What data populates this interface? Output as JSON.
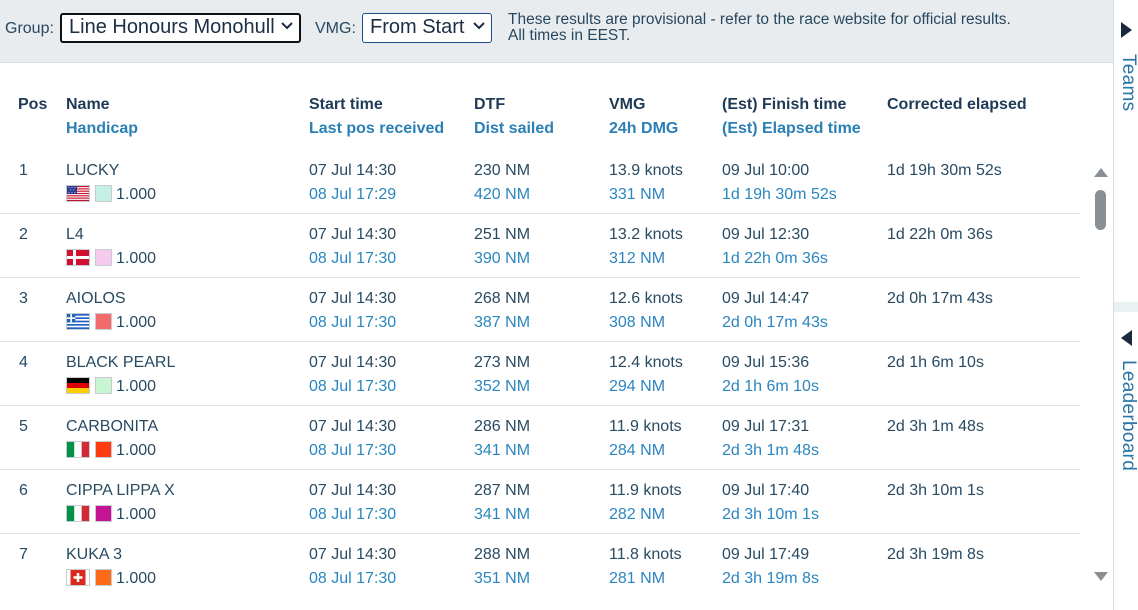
{
  "toolbar": {
    "group_label": "Group:",
    "group_value": "Line Honours Monohull",
    "vmg_label": "VMG:",
    "vmg_value": "From Start",
    "notice_line1": "These results are provisional - refer to the race website for official results.",
    "notice_line2": "All times in EEST."
  },
  "side_tabs": {
    "teams": "Teams",
    "leaderboard": "Leaderboard"
  },
  "columns": [
    {
      "main": "Pos",
      "sub": ""
    },
    {
      "main": "Name",
      "sub": "Handicap"
    },
    {
      "main": "Start time",
      "sub": "Last pos received"
    },
    {
      "main": "DTF",
      "sub": "Dist sailed"
    },
    {
      "main": "VMG",
      "sub": "24h DMG"
    },
    {
      "main": "(Est) Finish time",
      "sub": "(Est) Elapsed time"
    },
    {
      "main": "Corrected elapsed",
      "sub": ""
    }
  ],
  "rows": [
    {
      "pos": "1",
      "name": "LUCKY",
      "flag": "us-flag",
      "color": "#c7f0e4",
      "handicap": "1.000",
      "start": "07 Jul 14:30",
      "last": "08 Jul 17:29",
      "dtf": "230 NM",
      "sailed": "420 NM",
      "vmg": "13.9 knots",
      "dmg": "331 NM",
      "finish": "09 Jul 10:00",
      "elapsed": "1d 19h 30m 52s",
      "corrected": "1d 19h 30m 52s"
    },
    {
      "pos": "2",
      "name": "L4",
      "flag": "dk-flag",
      "color": "#f6c9ee",
      "handicap": "1.000",
      "start": "07 Jul 14:30",
      "last": "08 Jul 17:30",
      "dtf": "251 NM",
      "sailed": "390 NM",
      "vmg": "13.2 knots",
      "dmg": "312 NM",
      "finish": "09 Jul 12:30",
      "elapsed": "1d 22h 0m 36s",
      "corrected": "1d 22h 0m 36s"
    },
    {
      "pos": "3",
      "name": "AIOLOS",
      "flag": "gr-flag",
      "color": "#f46b6b",
      "handicap": "1.000",
      "start": "07 Jul 14:30",
      "last": "08 Jul 17:30",
      "dtf": "268 NM",
      "sailed": "387 NM",
      "vmg": "12.6 knots",
      "dmg": "308 NM",
      "finish": "09 Jul 14:47",
      "elapsed": "2d 0h 17m 43s",
      "corrected": "2d 0h 17m 43s"
    },
    {
      "pos": "4",
      "name": "BLACK PEARL",
      "flag": "de-flag",
      "color": "#c9f5d2",
      "handicap": "1.000",
      "start": "07 Jul 14:30",
      "last": "08 Jul 17:30",
      "dtf": "273 NM",
      "sailed": "352 NM",
      "vmg": "12.4 knots",
      "dmg": "294 NM",
      "finish": "09 Jul 15:36",
      "elapsed": "2d 1h 6m 10s",
      "corrected": "2d 1h 6m 10s"
    },
    {
      "pos": "5",
      "name": "CARBONITA",
      "flag": "it-flag",
      "color": "#ff3b10",
      "handicap": "1.000",
      "start": "07 Jul 14:30",
      "last": "08 Jul 17:30",
      "dtf": "286 NM",
      "sailed": "341 NM",
      "vmg": "11.9 knots",
      "dmg": "284 NM",
      "finish": "09 Jul 17:31",
      "elapsed": "2d 3h 1m 48s",
      "corrected": "2d 3h 1m 48s"
    },
    {
      "pos": "6",
      "name": "CIPPA LIPPA X",
      "flag": "it-flag",
      "color": "#c41493",
      "handicap": "1.000",
      "start": "07 Jul 14:30",
      "last": "08 Jul 17:30",
      "dtf": "287 NM",
      "sailed": "341 NM",
      "vmg": "11.9 knots",
      "dmg": "282 NM",
      "finish": "09 Jul 17:40",
      "elapsed": "2d 3h 10m 1s",
      "corrected": "2d 3h 10m 1s"
    },
    {
      "pos": "7",
      "name": "KUKA 3",
      "flag": "ch-flag",
      "color": "#ff6a18",
      "handicap": "1.000",
      "start": "07 Jul 14:30",
      "last": "08 Jul 17:30",
      "dtf": "288 NM",
      "sailed": "351 NM",
      "vmg": "11.8 knots",
      "dmg": "281 NM",
      "finish": "09 Jul 17:49",
      "elapsed": "2d 3h 19m 8s",
      "corrected": "2d 3h 19m 8s"
    }
  ]
}
